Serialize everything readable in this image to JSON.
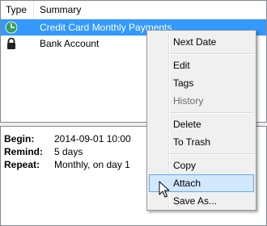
{
  "list": {
    "columns": {
      "type": "Type",
      "summary": "Summary"
    },
    "rows": [
      {
        "icon": "clock-icon",
        "summary": "Credit Card Monthly Payments",
        "selected": true
      },
      {
        "icon": "lock-icon",
        "summary": "Bank Account",
        "selected": false
      }
    ]
  },
  "details": {
    "begin_label": "Begin:",
    "begin_value": "2014-09-01 10:00",
    "remind_label": "Remind:",
    "remind_value": "5 days",
    "repeat_label": "Repeat:",
    "repeat_value": "Monthly, on day 1"
  },
  "context_menu": {
    "items": [
      {
        "label": "Next Date",
        "enabled": true
      },
      {
        "label": "Edit",
        "enabled": true
      },
      {
        "label": "Tags",
        "enabled": true
      },
      {
        "label": "History",
        "enabled": false
      },
      {
        "label": "Delete",
        "enabled": true
      },
      {
        "label": "To Trash",
        "enabled": true
      },
      {
        "label": "Copy",
        "enabled": true
      },
      {
        "label": "Attach",
        "enabled": true,
        "highlighted": true
      },
      {
        "label": "Save As...",
        "enabled": true
      }
    ]
  },
  "colors": {
    "selection": "#3399ff",
    "clock_icon": "#3a9d5a",
    "menu_highlight": "#d1e8ff"
  }
}
